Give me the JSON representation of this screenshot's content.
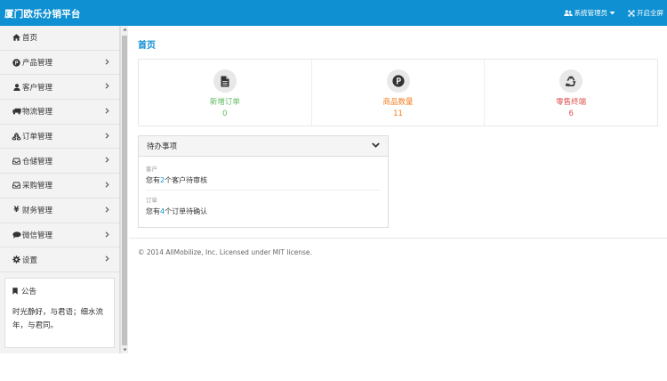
{
  "app": {
    "title": "厦门欧乐分销平台"
  },
  "topbar": {
    "user_label": "系统管理员",
    "fullscreen_label": "开启全屏"
  },
  "sidebar": {
    "items": [
      {
        "label": "首页"
      },
      {
        "label": "产品管理"
      },
      {
        "label": "客户管理"
      },
      {
        "label": "物流管理"
      },
      {
        "label": "订单管理"
      },
      {
        "label": "仓储管理"
      },
      {
        "label": "采购管理"
      },
      {
        "label": "财务管理"
      },
      {
        "label": "微信管理"
      },
      {
        "label": "设置"
      }
    ],
    "yen_glyph": "¥"
  },
  "notice": {
    "title": "公告",
    "text": "时光静好，与君语；细水流年，与君同。"
  },
  "main": {
    "page_title": "首页",
    "stats": [
      {
        "label": "新增订单",
        "value": "0",
        "color": "#5eb95e"
      },
      {
        "label": "商品数量",
        "value": "11",
        "color": "#f37b1d"
      },
      {
        "label": "零售终端",
        "value": "6",
        "color": "#dd514c"
      }
    ],
    "stat_icons": [
      "file-icon",
      "parking-icon",
      "recycle-icon"
    ],
    "todo": {
      "title": "待办事项",
      "items": [
        {
          "category": "客户",
          "prefix": "您有",
          "count": "2",
          "suffix": "个客户待审核"
        },
        {
          "category": "订单",
          "prefix": "您有",
          "count": "4",
          "suffix": "个订单待确认"
        }
      ]
    },
    "footer": "© 2014 AllMobilize, Inc. Licensed under MIT license."
  },
  "colors": {
    "brand": "#0e90d2",
    "sidebar_bg": "#f3f3f3",
    "accent_link": "#0e90d2"
  }
}
